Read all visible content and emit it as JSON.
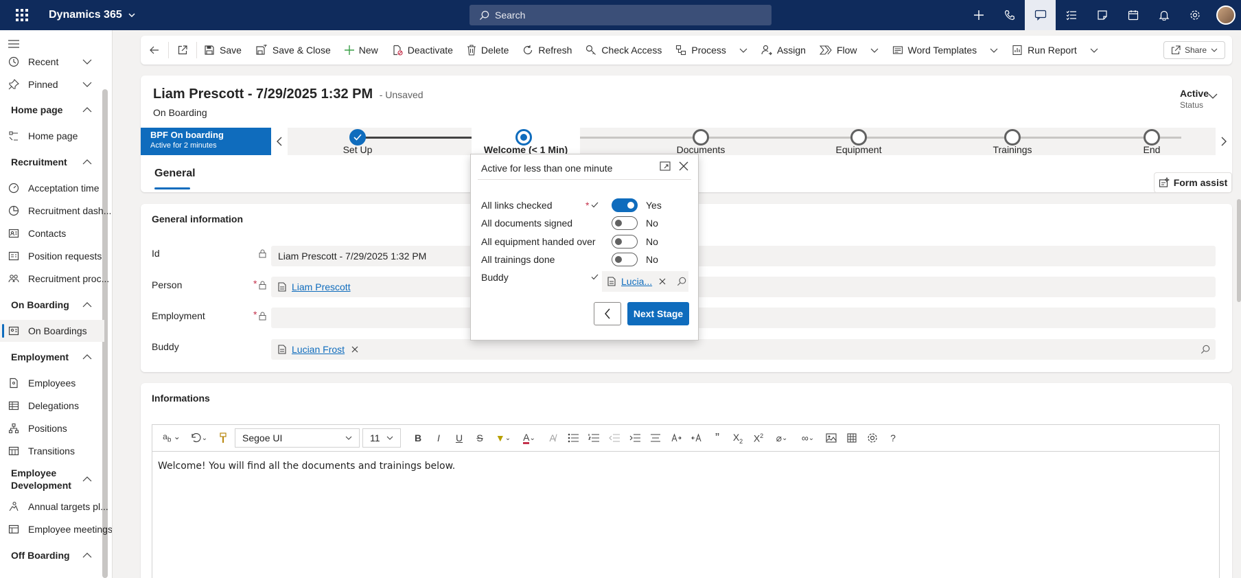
{
  "app": {
    "name": "Dynamics 365",
    "search_placeholder": "Search"
  },
  "sidebar": {
    "recent": "Recent",
    "pinned": "Pinned",
    "groups": [
      {
        "title": "Home page",
        "items": [
          "Home page"
        ]
      },
      {
        "title": "Recruitment",
        "items": [
          "Acceptation time",
          "Recruitment dash...",
          "Contacts",
          "Position requests",
          "Recruitment proc..."
        ]
      },
      {
        "title": "On Boarding",
        "items": [
          "On Boardings"
        ]
      },
      {
        "title": "Employment",
        "items": [
          "Employees",
          "Delegations",
          "Positions",
          "Transitions"
        ]
      },
      {
        "title": "Employee Development",
        "items": [
          "Annual targets pl...",
          "Employee meetings"
        ]
      },
      {
        "title": "Off Boarding",
        "items": []
      }
    ]
  },
  "toolbar": {
    "save": "Save",
    "save_close": "Save & Close",
    "new": "New",
    "deactivate": "Deactivate",
    "delete": "Delete",
    "refresh": "Refresh",
    "check_access": "Check Access",
    "process": "Process",
    "assign": "Assign",
    "flow": "Flow",
    "word_templates": "Word Templates",
    "run_report": "Run Report",
    "share": "Share"
  },
  "record": {
    "title": "Liam Prescott - 7/29/2025 1:32 PM",
    "unsaved": "- Unsaved",
    "entity": "On Boarding",
    "status_value": "Active",
    "status_label": "Status"
  },
  "bpf": {
    "name": "BPF On boarding",
    "active_for": "Active for 2 minutes",
    "stages": [
      "Set Up",
      "Welcome  (< 1 Min)",
      "Documents",
      "Equipment",
      "Trainings",
      "End"
    ],
    "completed_stages": 1,
    "active_stage_index": 1
  },
  "tabs": {
    "general": "General",
    "form_assist": "Form assist"
  },
  "general_info": {
    "title": "General information",
    "id_label": "Id",
    "id_value": "Liam Prescott - 7/29/2025 1:32 PM",
    "person_label": "Person",
    "person_value": "Liam Prescott",
    "employment_label": "Employment",
    "buddy_label": "Buddy",
    "buddy_value": "Lucian Frost",
    "required_mark": "*"
  },
  "informations": {
    "title": "Informations",
    "font": "Segoe UI",
    "size": "11",
    "content": "Welcome! You will find all the documents and trainings below."
  },
  "flyout": {
    "title": "Active for less than one minute",
    "rows": [
      {
        "label": "All links checked",
        "value": "Yes",
        "on": true
      },
      {
        "label": "All documents signed",
        "value": "No",
        "on": false
      },
      {
        "label": "All equipment handed over",
        "value": "No",
        "on": false
      },
      {
        "label": "All trainings done",
        "value": "No",
        "on": false
      }
    ],
    "buddy_label": "Buddy",
    "buddy_value": "Lucia...",
    "next_stage": "Next Stage"
  },
  "colors": {
    "nav": "#0f2b5c",
    "accent": "#0f6cbd",
    "required": "#c4314b"
  }
}
